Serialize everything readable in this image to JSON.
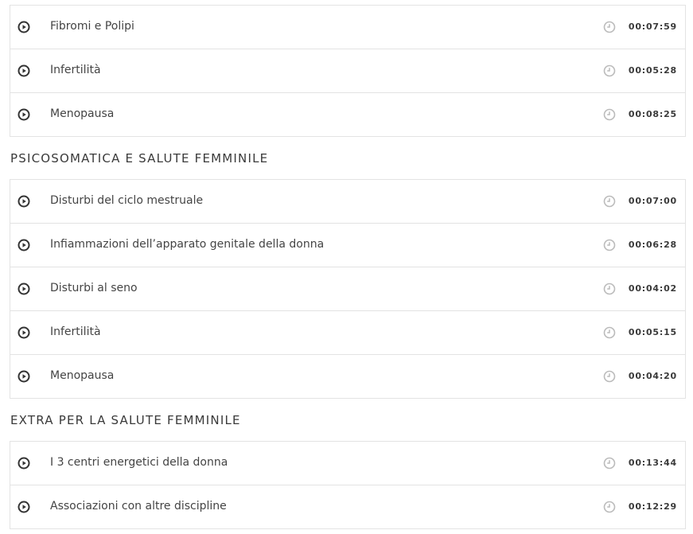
{
  "colors": {
    "border": "#e3e3e3",
    "text": "#444444",
    "heading": "#3a3a3a",
    "play_icon": "#333333",
    "clock_icon": "#bbbbbb"
  },
  "icons": {
    "play": "play-circle-icon",
    "duration": "clock-icon"
  },
  "sections": [
    {
      "title": "",
      "lessons": [
        {
          "title": "Fibromi e Polipi",
          "duration": "00:07:59"
        },
        {
          "title": "Infertilità",
          "duration": "00:05:28"
        },
        {
          "title": "Menopausa",
          "duration": "00:08:25"
        }
      ]
    },
    {
      "title": "PSICOSOMATICA E SALUTE FEMMINILE",
      "lessons": [
        {
          "title": "Disturbi del ciclo mestruale",
          "duration": "00:07:00"
        },
        {
          "title": "Infiammazioni dell’apparato genitale della donna",
          "duration": "00:06:28"
        },
        {
          "title": "Disturbi al seno",
          "duration": "00:04:02"
        },
        {
          "title": "Infertilità",
          "duration": "00:05:15"
        },
        {
          "title": "Menopausa",
          "duration": "00:04:20"
        }
      ]
    },
    {
      "title": "EXTRA PER LA SALUTE FEMMINILE",
      "lessons": [
        {
          "title": "I 3 centri energetici della donna",
          "duration": "00:13:44"
        },
        {
          "title": "Associazioni con altre discipline",
          "duration": "00:12:29"
        }
      ]
    }
  ]
}
